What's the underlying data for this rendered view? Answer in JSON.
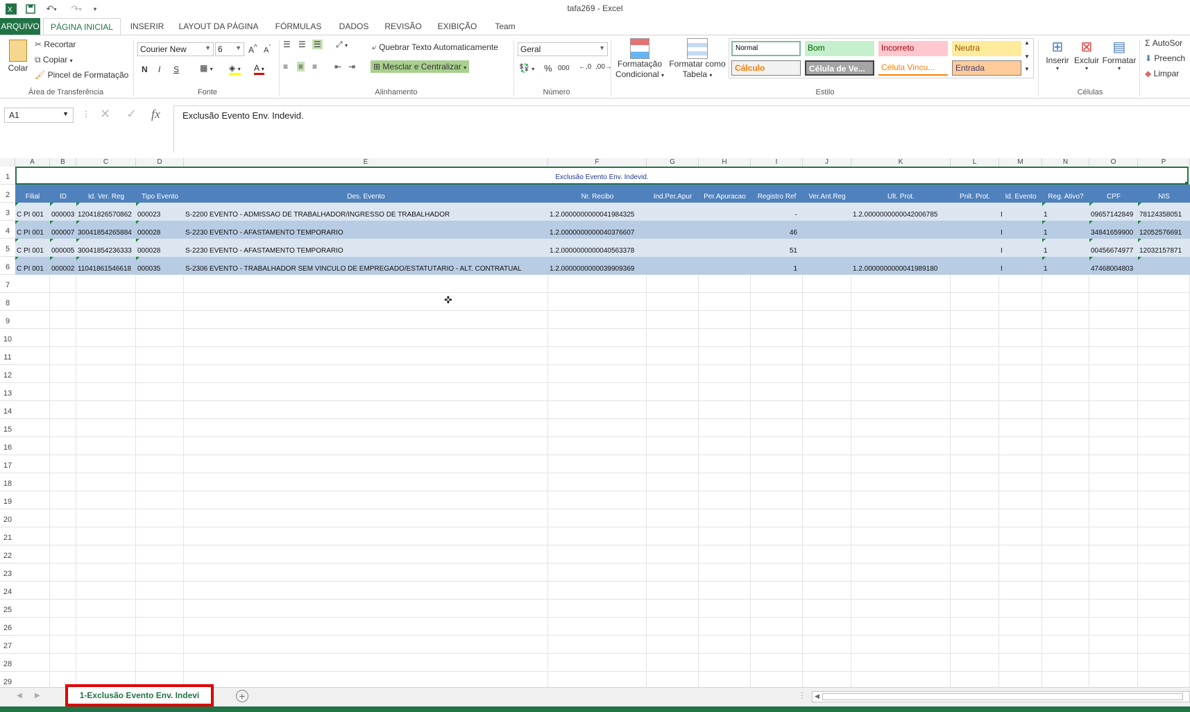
{
  "app": {
    "window_title": "tafa269 - Excel"
  },
  "quick_access": {
    "excel_icon": "excel-logo-icon",
    "save_icon": "save-icon",
    "undo_icon": "undo-icon",
    "redo_icon": "redo-icon",
    "customize_icon": "customize-icon"
  },
  "tabs": [
    "ARQUIVO",
    "PÁGINA INICIAL",
    "INSERIR",
    "LAYOUT DA PÁGINA",
    "FÓRMULAS",
    "DADOS",
    "REVISÃO",
    "EXIBIÇÃO",
    "Team"
  ],
  "ribbon": {
    "clipboard": {
      "paste": "Colar",
      "cut": "Recortar",
      "copy": "Copiar",
      "format_painter": "Pincel de Formatação",
      "group": "Área de Transferência"
    },
    "font": {
      "family": "Courier New",
      "size": "6",
      "bold": "N",
      "italic": "I",
      "underline": "S",
      "group": "Fonte"
    },
    "alignment": {
      "wrap": "Quebrar Texto Automaticamente",
      "merge": "Mesclar e Centralizar",
      "group": "Alinhamento"
    },
    "number": {
      "format": "Geral",
      "percent": "%",
      "thousands": "000",
      "group": "Número"
    },
    "styles": {
      "conditional": "Formatação Condicional",
      "table": "Formatar como Tabela",
      "items": [
        {
          "label": "Normal",
          "bg": "#ffffff",
          "fg": "#000000"
        },
        {
          "label": "Bom",
          "bg": "#c6efce",
          "fg": "#006100"
        },
        {
          "label": "Incorreto",
          "bg": "#ffc7ce",
          "fg": "#9c0006"
        },
        {
          "label": "Neutra",
          "bg": "#ffeb9c",
          "fg": "#9c5700"
        },
        {
          "label": "Cálculo",
          "bg": "#f2f2f2",
          "fg": "#fa7d00"
        },
        {
          "label": "Célula de Ve...",
          "bg": "#a5a5a5",
          "fg": "#ffffff"
        },
        {
          "label": "Célula Vincu...",
          "bg": "#ffffff",
          "fg": "#fa7d00"
        },
        {
          "label": "Entrada",
          "bg": "#ffcc99",
          "fg": "#3f3f76"
        }
      ],
      "group": "Estilo"
    },
    "cells": {
      "insert": "Inserir",
      "delete": "Excluir",
      "format": "Formatar",
      "group": "Células"
    },
    "editing": {
      "autosum": "AutoSor",
      "fill": "Preench",
      "clear": "Limpar"
    }
  },
  "formula_bar": {
    "name_box": "A1",
    "fx": "fx",
    "content": "Exclusão Evento Env. Indevid."
  },
  "sheet": {
    "columns": [
      "A",
      "B",
      "C",
      "D",
      "E",
      "F",
      "G",
      "H",
      "I",
      "J",
      "K",
      "L",
      "M",
      "N",
      "O",
      "P"
    ],
    "title": "Exclusão Evento Env. Indevid.",
    "headers": [
      "Filial",
      "ID",
      "Id. Ver. Reg",
      "Tipo Evento",
      "Des. Evento",
      "Nr. Recibo",
      "Ind.Per.Apur",
      "Per.Apuracao",
      "Registro Ref",
      "Ver.Ant.Reg",
      "Ult. Prot.",
      "Pnlt. Prot.",
      "Id. Evento",
      "Reg. Ativo?",
      "CPF",
      "NIS"
    ],
    "rows": [
      [
        "C PI 001",
        "000003",
        "12041826570862",
        "000023",
        "S-2200 EVENTO - ADMISSAO DE TRABALHADOR/INGRESSO DE TRABALHADOR",
        "1.2.0000000000041984325",
        "",
        "",
        "-",
        "",
        "1.2.0000000000042006785",
        "",
        "I",
        "1",
        "09657142849",
        "78124358051"
      ],
      [
        "C PI 001",
        "000007",
        "30041854265884",
        "000028",
        "S-2230 EVENTO - AFASTAMENTO TEMPORARIO",
        "1.2.0000000000040376607",
        "",
        "",
        "46",
        "",
        "",
        "",
        "I",
        "1",
        "34841659900",
        "12052576691"
      ],
      [
        "C PI 001",
        "000005",
        "30041854236333",
        "000028",
        "S-2230 EVENTO - AFASTAMENTO TEMPORARIO",
        "1.2.0000000000040563378",
        "",
        "",
        "51",
        "",
        "",
        "",
        "I",
        "1",
        "00456674977",
        "12032157871"
      ],
      [
        "C PI 001",
        "000002",
        "11041861546618",
        "000035",
        "S-2306 EVENTO - TRABALHADOR SEM VINCULO DE EMPREGADO/ESTATUTÁRIO - ALT. CONTRATUAL",
        "1.2.0000000000039909369",
        "",
        "",
        "1",
        "",
        "1.2.0000000000041989180",
        "",
        "I",
        "1",
        "47468004803",
        ""
      ]
    ],
    "row_numbers": [
      "1",
      "2",
      "3",
      "4",
      "5",
      "6",
      "7",
      "8",
      "9",
      "10",
      "11",
      "12",
      "13",
      "14",
      "15",
      "16",
      "17",
      "18",
      "19",
      "20",
      "21",
      "22",
      "23",
      "24",
      "25",
      "26",
      "27",
      "28",
      "29"
    ]
  },
  "sheet_tabs": {
    "active": "1-Exclusão Evento Env. Indevi"
  },
  "colors": {
    "excel_green": "#217346",
    "header_blue": "#4f81bd",
    "row_light": "#dce6f1",
    "row_dark": "#b8cce4",
    "highlight_red": "#e00000"
  }
}
